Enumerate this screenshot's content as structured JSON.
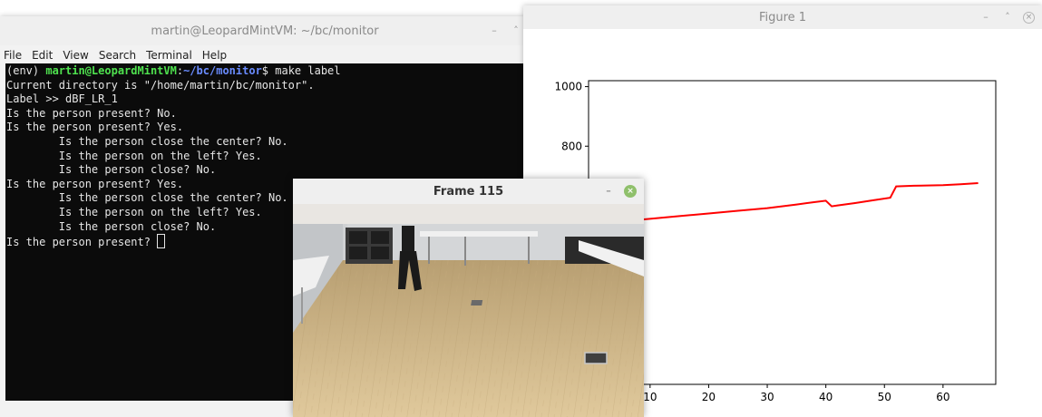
{
  "terminal": {
    "title": "martin@LeopardMintVM: ~/bc/monitor",
    "menu": [
      "File",
      "Edit",
      "View",
      "Search",
      "Terminal",
      "Help"
    ],
    "prompt_env": "(env) ",
    "prompt_user": "martin@LeopardMintVM",
    "prompt_sep": ":",
    "prompt_path": "~/bc/monitor",
    "prompt_end": "$ make label",
    "lines": [
      "Current directory is \"/home/martin/bc/monitor\".",
      "Label >> dBF_LR_1",
      "Is the person present? No.",
      "Is the person present? Yes.",
      "        Is the person close the center? No.",
      "        Is the person on the left? Yes.",
      "        Is the person close? No.",
      "Is the person present? Yes.",
      "        Is the person close the center? No.",
      "        Is the person on the left? Yes.",
      "        Is the person close? No."
    ],
    "last_line": "Is the person present? "
  },
  "figure": {
    "title": "Figure 1",
    "minimize_icon": "minimize-icon",
    "close_icon": "close-icon"
  },
  "frame_window": {
    "title": "Frame 115",
    "minimize_glyph": "–",
    "close_glyph": "×"
  },
  "chart_data": {
    "type": "line",
    "title": "",
    "xlabel": "",
    "ylabel": "",
    "x_ticks": [
      10,
      20,
      30,
      40,
      50,
      60
    ],
    "y_ticks": [
      800,
      1000
    ],
    "xlim": [
      -0.5,
      69
    ],
    "ylim": [
      0,
      1020
    ],
    "color": "#ff0000",
    "series": [
      {
        "x": [
          0,
          5,
          10,
          15,
          20,
          25,
          30,
          35,
          38,
          40,
          41,
          42,
          45,
          48,
          51,
          52,
          55,
          60,
          63,
          66
        ],
        "y": [
          540,
          547,
          556,
          565,
          574,
          583,
          592,
          604,
          612,
          617,
          598,
          601,
          609,
          618,
          627,
          665,
          667,
          669,
          672,
          676
        ]
      }
    ]
  }
}
